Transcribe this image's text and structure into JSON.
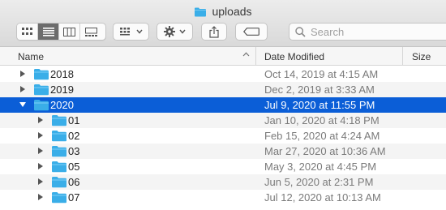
{
  "window": {
    "title": "uploads",
    "folder_color": "#3aaee8"
  },
  "toolbar": {
    "view_buttons": [
      {
        "icon": "icon-view-icon",
        "active": false
      },
      {
        "icon": "list-view-icon",
        "active": true
      },
      {
        "icon": "column-view-icon",
        "active": false
      },
      {
        "icon": "gallery-view-icon",
        "active": false
      }
    ],
    "group_button_icon": "group-by-icon",
    "action_button_icon": "gear-icon",
    "share_button_icon": "share-icon",
    "tags_button_icon": "tag-icon",
    "search": {
      "placeholder": "Search",
      "value": ""
    }
  },
  "columns": {
    "name": "Name",
    "date_modified": "Date Modified",
    "size": "Size"
  },
  "rows": [
    {
      "name": "2018",
      "date": "Oct 14, 2019 at 4:15 AM",
      "level": 0,
      "expanded": false,
      "selected": false
    },
    {
      "name": "2019",
      "date": "Dec 2, 2019 at 3:33 AM",
      "level": 0,
      "expanded": false,
      "selected": false
    },
    {
      "name": "2020",
      "date": "Jul 9, 2020 at 11:55 PM",
      "level": 0,
      "expanded": true,
      "selected": true
    },
    {
      "name": "01",
      "date": "Jan 10, 2020 at 4:18 PM",
      "level": 1,
      "expanded": false,
      "selected": false
    },
    {
      "name": "02",
      "date": "Feb 15, 2020 at 4:24 AM",
      "level": 1,
      "expanded": false,
      "selected": false
    },
    {
      "name": "03",
      "date": "Mar 27, 2020 at 10:36 AM",
      "level": 1,
      "expanded": false,
      "selected": false
    },
    {
      "name": "05",
      "date": "May 3, 2020 at 4:45 PM",
      "level": 1,
      "expanded": false,
      "selected": false
    },
    {
      "name": "06",
      "date": "Jun 5, 2020 at 2:31 PM",
      "level": 1,
      "expanded": false,
      "selected": false
    },
    {
      "name": "07",
      "date": "Jul 12, 2020 at 10:13 AM",
      "level": 1,
      "expanded": false,
      "selected": false
    }
  ],
  "colors": {
    "selection": "#0b5ed7",
    "folder": "#3aaee8",
    "date_text": "#7a7a7a"
  }
}
